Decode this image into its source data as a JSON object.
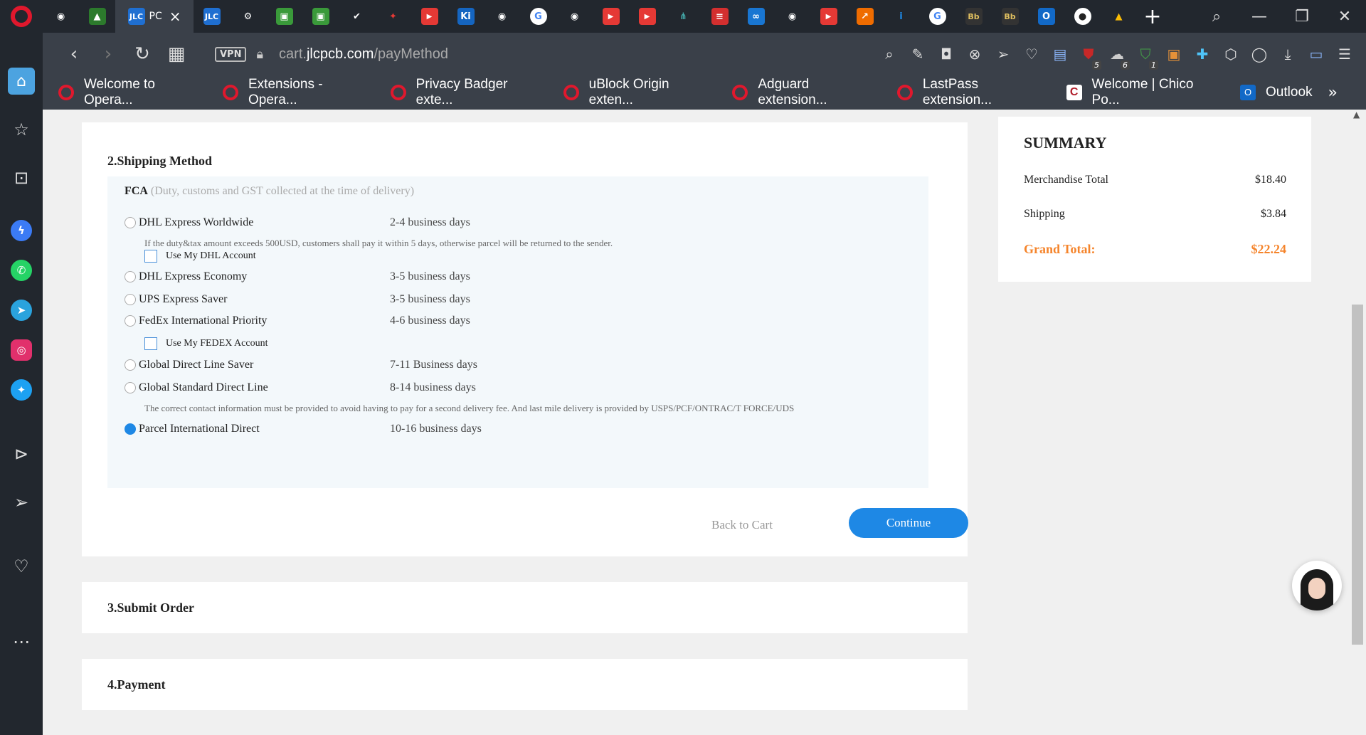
{
  "browser": {
    "active_tab_title": "PC",
    "active_tab_favicon": "JLC",
    "nav": {
      "back": "‹",
      "forward": "›",
      "reload": "↻",
      "speed_dial": "▦"
    },
    "vpn_label": "VPN",
    "url_prefix": "cart.",
    "url_domain": "jlcpcb.com",
    "url_path": "/payMethod",
    "tab_add": "+",
    "window_controls": {
      "search": "⌕",
      "minimize": "—",
      "restore": "❐",
      "close": "✕"
    },
    "extension_badges": {
      "ublock": "5",
      "adblock": "6",
      "adguard": "1"
    },
    "bookmarks": [
      {
        "label": "Welcome to Opera...",
        "icon": "opera-icon"
      },
      {
        "label": "Extensions - Opera...",
        "icon": "opera-icon"
      },
      {
        "label": "Privacy Badger exte...",
        "icon": "opera-icon"
      },
      {
        "label": "uBlock Origin exten...",
        "icon": "opera-icon"
      },
      {
        "label": "Adguard extension...",
        "icon": "opera-icon"
      },
      {
        "label": "LastPass extension...",
        "icon": "opera-icon"
      },
      {
        "label": "Welcome | Chico Po...",
        "icon": "chico-icon"
      },
      {
        "label": "Outlook",
        "icon": "outlook-icon"
      }
    ],
    "bookmarks_more": "»"
  },
  "shipping": {
    "title": "2.Shipping Method",
    "fca_label": "FCA",
    "fca_note": "(Duty, customs and GST collected at the time of delivery)",
    "options": [
      {
        "name": "DHL Express Worldwide",
        "days": "2-4 business days",
        "selected": false
      },
      {
        "name": "DHL Express Economy",
        "days": "3-5 business days",
        "selected": false
      },
      {
        "name": "UPS Express Saver",
        "days": "3-5 business days",
        "selected": false
      },
      {
        "name": "FedEx International Priority",
        "days": "4-6 business days",
        "selected": false
      },
      {
        "name": "Global Direct Line Saver",
        "days": "7-11 Business days",
        "selected": false
      },
      {
        "name": "Global Standard Direct Line",
        "days": "8-14 business days",
        "selected": false
      },
      {
        "name": "Parcel International Direct",
        "days": "10-16 business days",
        "selected": true
      }
    ],
    "dhl_note": "If the duty&tax amount exceeds 500USD, customers shall pay it within 5 days, otherwise parcel will be returned to the sender.",
    "dhl_account_label": "Use My DHL Account",
    "fedex_account_label": "Use My FEDEX Account",
    "global_standard_note": "The correct contact information must be provided to avoid having to pay for a second delivery fee. And last mile delivery is provided by USPS/PCF/ONTRAC/T FORCE/UDS",
    "back_label": "Back to Cart",
    "continue_label": "Continue"
  },
  "submit_order": {
    "title": "3.Submit Order"
  },
  "payment": {
    "title": "4.Payment"
  },
  "summary": {
    "title": "SUMMARY",
    "merchandise_label": "Merchandise Total",
    "merchandise_value": "$18.40",
    "shipping_label": "Shipping",
    "shipping_value": "$3.84",
    "grand_label": "Grand Total:",
    "grand_value": "$22.24"
  },
  "colors": {
    "accent": "#1e88e5",
    "grand_total": "#f5842b",
    "opera_red": "#e0182d"
  }
}
